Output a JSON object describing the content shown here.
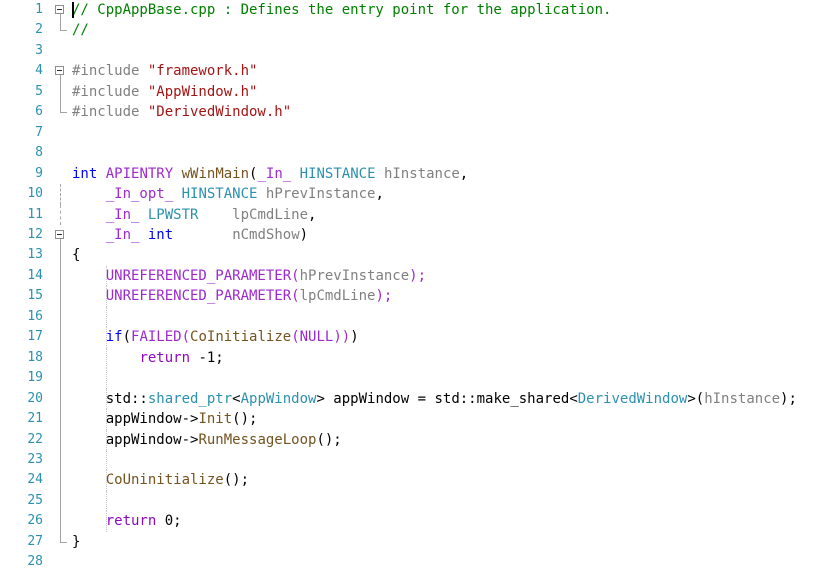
{
  "editor": {
    "background": "#ffffff",
    "gutter_color": "#2B91AF",
    "fold_line_color": "#A3A3A3",
    "indent_guide_color": "#C9C9C9",
    "caret_color": "#000000",
    "token_colors": {
      "pln": "#000000",
      "com": "#008000",
      "str": "#A31515",
      "pre": "#808080",
      "mac": "#9E29CF",
      "kw": "#0000FF",
      "ctl": "#8F08C4",
      "typ": "#2B91AF",
      "fn": "#74531F",
      "par": "#808080"
    },
    "caret": {
      "line": 1,
      "column": 0
    },
    "indent_guide_lines": [
      14,
      15,
      16,
      17,
      18,
      19,
      20,
      21,
      22,
      23,
      24,
      25,
      26
    ],
    "fold_margin": {
      "1": "box",
      "2": "end",
      "4": "box",
      "5": "line",
      "6": "end",
      "10": "dots",
      "11": "dots",
      "12": "box",
      "13": "line",
      "14": "line",
      "15": "line",
      "16": "line",
      "17": "line",
      "18": "line",
      "19": "line",
      "20": "line",
      "21": "line",
      "22": "line",
      "23": "line",
      "24": "line",
      "25": "line",
      "26": "line",
      "27": "end"
    },
    "lines": [
      {
        "num": 1,
        "tokens": [
          {
            "c": "com",
            "t": "// CppAppBase.cpp : Defines the entry point for the application."
          }
        ]
      },
      {
        "num": 2,
        "tokens": [
          {
            "c": "com",
            "t": "//"
          }
        ]
      },
      {
        "num": 3,
        "tokens": []
      },
      {
        "num": 4,
        "tokens": [
          {
            "c": "pre",
            "t": "#include "
          },
          {
            "c": "str",
            "t": "\"framework.h\""
          }
        ]
      },
      {
        "num": 5,
        "tokens": [
          {
            "c": "pre",
            "t": "#include "
          },
          {
            "c": "str",
            "t": "\"AppWindow.h\""
          }
        ]
      },
      {
        "num": 6,
        "tokens": [
          {
            "c": "pre",
            "t": "#include "
          },
          {
            "c": "str",
            "t": "\"DerivedWindow.h\""
          }
        ]
      },
      {
        "num": 7,
        "tokens": []
      },
      {
        "num": 8,
        "tokens": []
      },
      {
        "num": 9,
        "tokens": [
          {
            "c": "kw",
            "t": "int"
          },
          {
            "c": "pln",
            "t": " "
          },
          {
            "c": "mac",
            "t": "APIENTRY"
          },
          {
            "c": "pln",
            "t": " "
          },
          {
            "c": "fn",
            "t": "wWinMain"
          },
          {
            "c": "pln",
            "t": "("
          },
          {
            "c": "mac",
            "t": "_In_"
          },
          {
            "c": "pln",
            "t": " "
          },
          {
            "c": "typ",
            "t": "HINSTANCE"
          },
          {
            "c": "pln",
            "t": " "
          },
          {
            "c": "par",
            "t": "hInstance"
          },
          {
            "c": "pln",
            "t": ","
          }
        ]
      },
      {
        "num": 10,
        "tokens": [
          {
            "c": "pln",
            "t": "    "
          },
          {
            "c": "mac",
            "t": "_In_opt_"
          },
          {
            "c": "pln",
            "t": " "
          },
          {
            "c": "typ",
            "t": "HINSTANCE"
          },
          {
            "c": "pln",
            "t": " "
          },
          {
            "c": "par",
            "t": "hPrevInstance"
          },
          {
            "c": "pln",
            "t": ","
          }
        ]
      },
      {
        "num": 11,
        "tokens": [
          {
            "c": "pln",
            "t": "    "
          },
          {
            "c": "mac",
            "t": "_In_"
          },
          {
            "c": "pln",
            "t": " "
          },
          {
            "c": "typ",
            "t": "LPWSTR"
          },
          {
            "c": "pln",
            "t": "    "
          },
          {
            "c": "par",
            "t": "lpCmdLine"
          },
          {
            "c": "pln",
            "t": ","
          }
        ]
      },
      {
        "num": 12,
        "tokens": [
          {
            "c": "pln",
            "t": "    "
          },
          {
            "c": "mac",
            "t": "_In_"
          },
          {
            "c": "pln",
            "t": " "
          },
          {
            "c": "kw",
            "t": "int"
          },
          {
            "c": "pln",
            "t": "       "
          },
          {
            "c": "par",
            "t": "nCmdShow"
          },
          {
            "c": "pln",
            "t": ")"
          }
        ]
      },
      {
        "num": 13,
        "tokens": [
          {
            "c": "pln",
            "t": "{"
          }
        ]
      },
      {
        "num": 14,
        "tokens": [
          {
            "c": "pln",
            "t": "    "
          },
          {
            "c": "mac",
            "t": "UNREFERENCED_PARAMETER("
          },
          {
            "c": "par",
            "t": "hPrevInstance"
          },
          {
            "c": "mac",
            "t": ");"
          }
        ]
      },
      {
        "num": 15,
        "tokens": [
          {
            "c": "pln",
            "t": "    "
          },
          {
            "c": "mac",
            "t": "UNREFERENCED_PARAMETER("
          },
          {
            "c": "par",
            "t": "lpCmdLine"
          },
          {
            "c": "mac",
            "t": ");"
          }
        ]
      },
      {
        "num": 16,
        "tokens": []
      },
      {
        "num": 17,
        "tokens": [
          {
            "c": "pln",
            "t": "    "
          },
          {
            "c": "kw",
            "t": "if"
          },
          {
            "c": "pln",
            "t": "("
          },
          {
            "c": "mac",
            "t": "FAILED("
          },
          {
            "c": "fn",
            "t": "CoInitialize"
          },
          {
            "c": "mac",
            "t": "(NULL))"
          },
          {
            "c": "pln",
            "t": ")"
          }
        ]
      },
      {
        "num": 18,
        "tokens": [
          {
            "c": "pln",
            "t": "        "
          },
          {
            "c": "ctl",
            "t": "return"
          },
          {
            "c": "pln",
            "t": " -1;"
          }
        ]
      },
      {
        "num": 19,
        "tokens": []
      },
      {
        "num": 20,
        "tokens": [
          {
            "c": "pln",
            "t": "    std::"
          },
          {
            "c": "typ",
            "t": "shared_ptr"
          },
          {
            "c": "pln",
            "t": "<"
          },
          {
            "c": "typ",
            "t": "AppWindow"
          },
          {
            "c": "pln",
            "t": "> appWindow = std::make_shared<"
          },
          {
            "c": "typ",
            "t": "DerivedWindow"
          },
          {
            "c": "pln",
            "t": ">("
          },
          {
            "c": "par",
            "t": "hInstance"
          },
          {
            "c": "pln",
            "t": ");"
          }
        ]
      },
      {
        "num": 21,
        "tokens": [
          {
            "c": "pln",
            "t": "    appWindow->"
          },
          {
            "c": "fn",
            "t": "Init"
          },
          {
            "c": "pln",
            "t": "();"
          }
        ]
      },
      {
        "num": 22,
        "tokens": [
          {
            "c": "pln",
            "t": "    appWindow->"
          },
          {
            "c": "fn",
            "t": "RunMessageLoop"
          },
          {
            "c": "pln",
            "t": "();"
          }
        ]
      },
      {
        "num": 23,
        "tokens": []
      },
      {
        "num": 24,
        "tokens": [
          {
            "c": "pln",
            "t": "    "
          },
          {
            "c": "fn",
            "t": "CoUninitialize"
          },
          {
            "c": "pln",
            "t": "();"
          }
        ]
      },
      {
        "num": 25,
        "tokens": []
      },
      {
        "num": 26,
        "tokens": [
          {
            "c": "pln",
            "t": "    "
          },
          {
            "c": "ctl",
            "t": "return"
          },
          {
            "c": "pln",
            "t": " 0;"
          }
        ]
      },
      {
        "num": 27,
        "tokens": [
          {
            "c": "pln",
            "t": "}"
          }
        ]
      },
      {
        "num": 28,
        "tokens": []
      }
    ]
  }
}
